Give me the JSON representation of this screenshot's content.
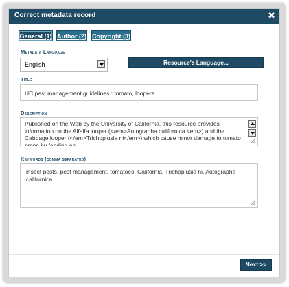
{
  "dialog": {
    "title": "Correct metadata record",
    "close_glyph": "✖"
  },
  "tabs": [
    {
      "label": "General (1)",
      "active": true
    },
    {
      "label": "Author (2)",
      "active": false
    },
    {
      "label": "Copyright (3)",
      "active": false
    }
  ],
  "metadata_language": {
    "label": "Metadata Language",
    "value": "English",
    "resource_button": "Resource's Language..."
  },
  "title_field": {
    "label": "Title",
    "value": "UC pest management guidelines :  tomato, loopers"
  },
  "description_field": {
    "label": "Description",
    "value": "Published on the Web by the University of California, this resource provides information on the Alfalfa looper (</em>Autographa californica <em>) and the Cabbage looper (</em>Trichoplusia ni</em>)  which cause minor damage to tomato crops by feeding on"
  },
  "keywords_field": {
    "label": "Keywords (comma separated)",
    "value": "insect pests, pest management, tomatoes, California, Trichoplusia ni, Autographa californica"
  },
  "footer": {
    "next_button": "Next >>"
  },
  "colors": {
    "titlebar": "#1e4a64",
    "tab": "#2b6f8c",
    "label": "#1e4a64"
  },
  "icons": {
    "close": "close-icon",
    "select_arrow": "chevron-down-icon",
    "scroll_up": "chevron-up-icon",
    "scroll_down": "chevron-down-icon",
    "resize": "resize-grip-icon"
  }
}
